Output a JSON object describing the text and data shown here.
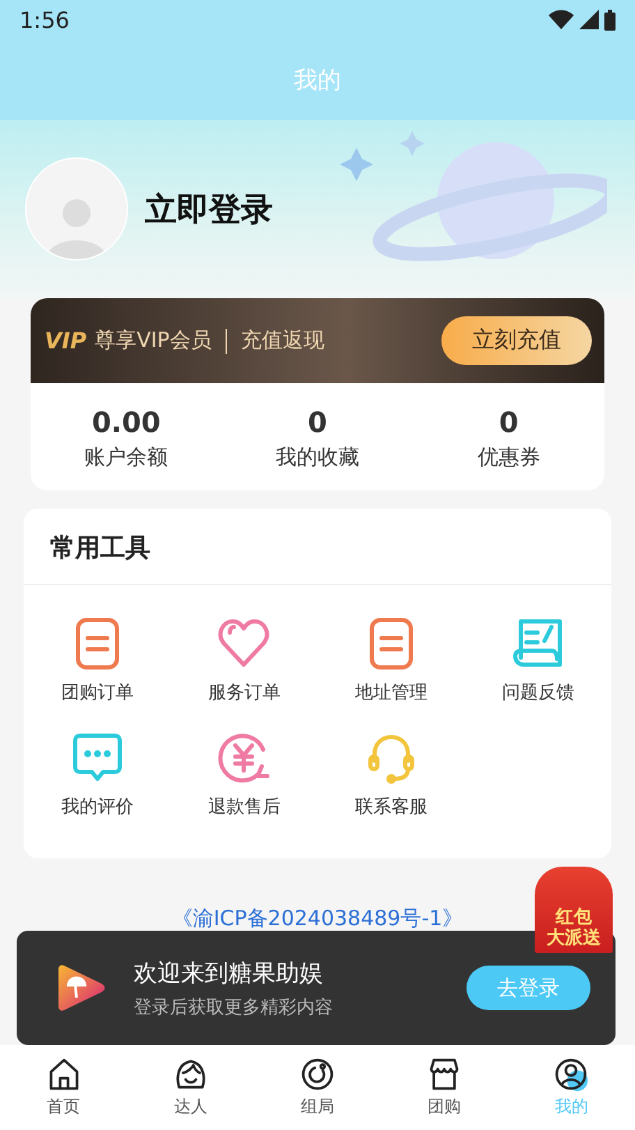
{
  "status_bar": {
    "time": "1:56"
  },
  "header": {
    "title": "我的"
  },
  "profile": {
    "login_text": "立即登录"
  },
  "vip": {
    "logo": "VIP",
    "text": "尊享VIP会员",
    "text_2": "充值返现",
    "button": "立刻充值"
  },
  "stats": [
    {
      "value": "0.00",
      "label": "账户余额"
    },
    {
      "value": "0",
      "label": "我的收藏"
    },
    {
      "value": "0",
      "label": "优惠券"
    }
  ],
  "tools": {
    "title": "常用工具",
    "items": [
      {
        "kind": "order",
        "label": "团购订单"
      },
      {
        "kind": "heart",
        "label": "服务订单"
      },
      {
        "kind": "order",
        "label": "地址管理"
      },
      {
        "kind": "feedback",
        "label": "问题反馈"
      },
      {
        "kind": "comment",
        "label": "我的评价"
      },
      {
        "kind": "refund",
        "label": "退款售后"
      },
      {
        "kind": "headset",
        "label": "联系客服"
      }
    ]
  },
  "footer": {
    "icp": "《渝ICP备2024038489号-1》"
  },
  "promo": {
    "line_1": "红包",
    "line_2": "大派送"
  },
  "toast": {
    "title": "欢迎来到糖果助娱",
    "subtitle": "登录后获取更多精彩内容",
    "button": "去登录"
  },
  "nav": [
    {
      "kind": "home",
      "label": "首页",
      "selected": false
    },
    {
      "kind": "person",
      "label": "达人",
      "selected": false
    },
    {
      "kind": "circle",
      "label": "组局",
      "selected": false
    },
    {
      "kind": "shop",
      "label": "团购",
      "selected": false
    },
    {
      "kind": "profile",
      "label": "我的",
      "selected": true
    }
  ]
}
